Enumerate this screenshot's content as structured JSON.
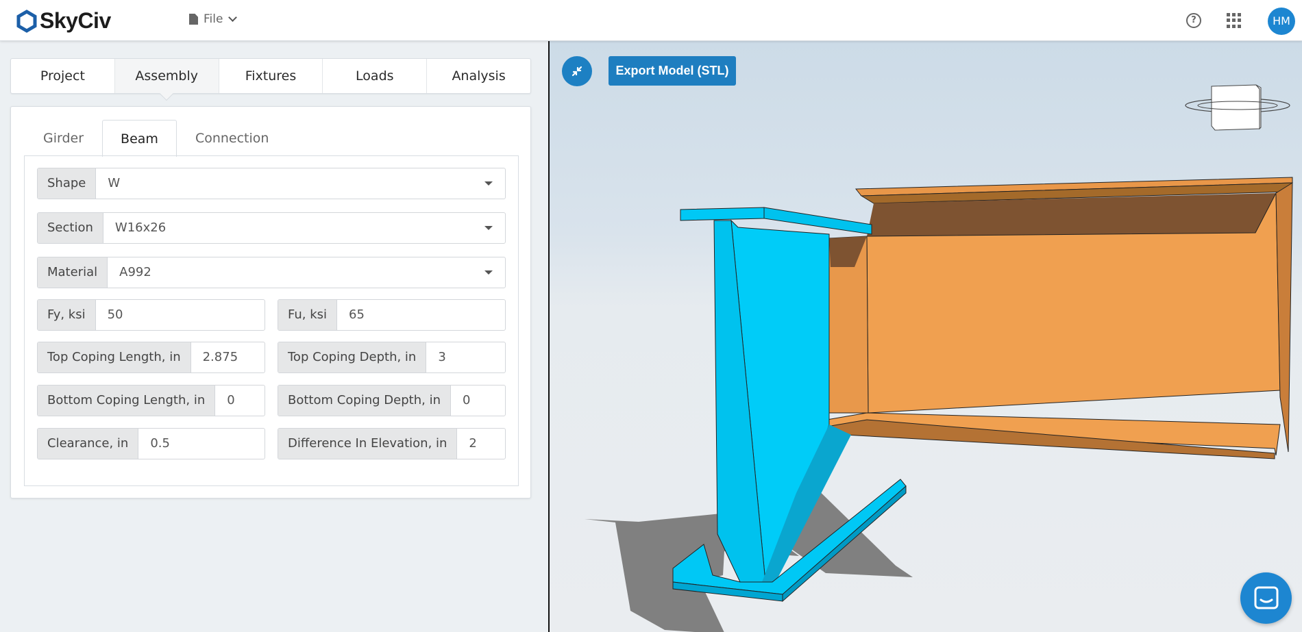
{
  "app": {
    "name": "SkyCiv",
    "file_menu": "File",
    "user_initials": "HM"
  },
  "main_tabs": [
    {
      "label": "Project"
    },
    {
      "label": "Assembly"
    },
    {
      "label": "Fixtures"
    },
    {
      "label": "Loads"
    },
    {
      "label": "Analysis"
    }
  ],
  "sub_tabs": [
    {
      "label": "Girder"
    },
    {
      "label": "Beam"
    },
    {
      "label": "Connection"
    }
  ],
  "beam": {
    "shape": {
      "label": "Shape",
      "value": "W"
    },
    "section": {
      "label": "Section",
      "value": "W16x26"
    },
    "material": {
      "label": "Material",
      "value": "A992"
    },
    "fy": {
      "label": "Fy, ksi",
      "value": "50"
    },
    "fu": {
      "label": "Fu, ksi",
      "value": "65"
    },
    "top_coping_length": {
      "label": "Top Coping Length, in",
      "value": "2.875"
    },
    "top_coping_depth": {
      "label": "Top Coping Depth, in",
      "value": "3"
    },
    "bottom_coping_length": {
      "label": "Bottom Coping Length, in",
      "value": "0"
    },
    "bottom_coping_depth": {
      "label": "Bottom Coping Depth, in",
      "value": "0"
    },
    "clearance": {
      "label": "Clearance, in",
      "value": "0.5"
    },
    "difference_in_elevation": {
      "label": "Difference In Elevation, in",
      "value": "2"
    }
  },
  "viewport": {
    "export_label": "Export Model (STL)",
    "colors": {
      "girder": "#00c8f5",
      "beam": "#f0a050",
      "shadow": "#808080",
      "accent": "#1d86d1"
    }
  }
}
